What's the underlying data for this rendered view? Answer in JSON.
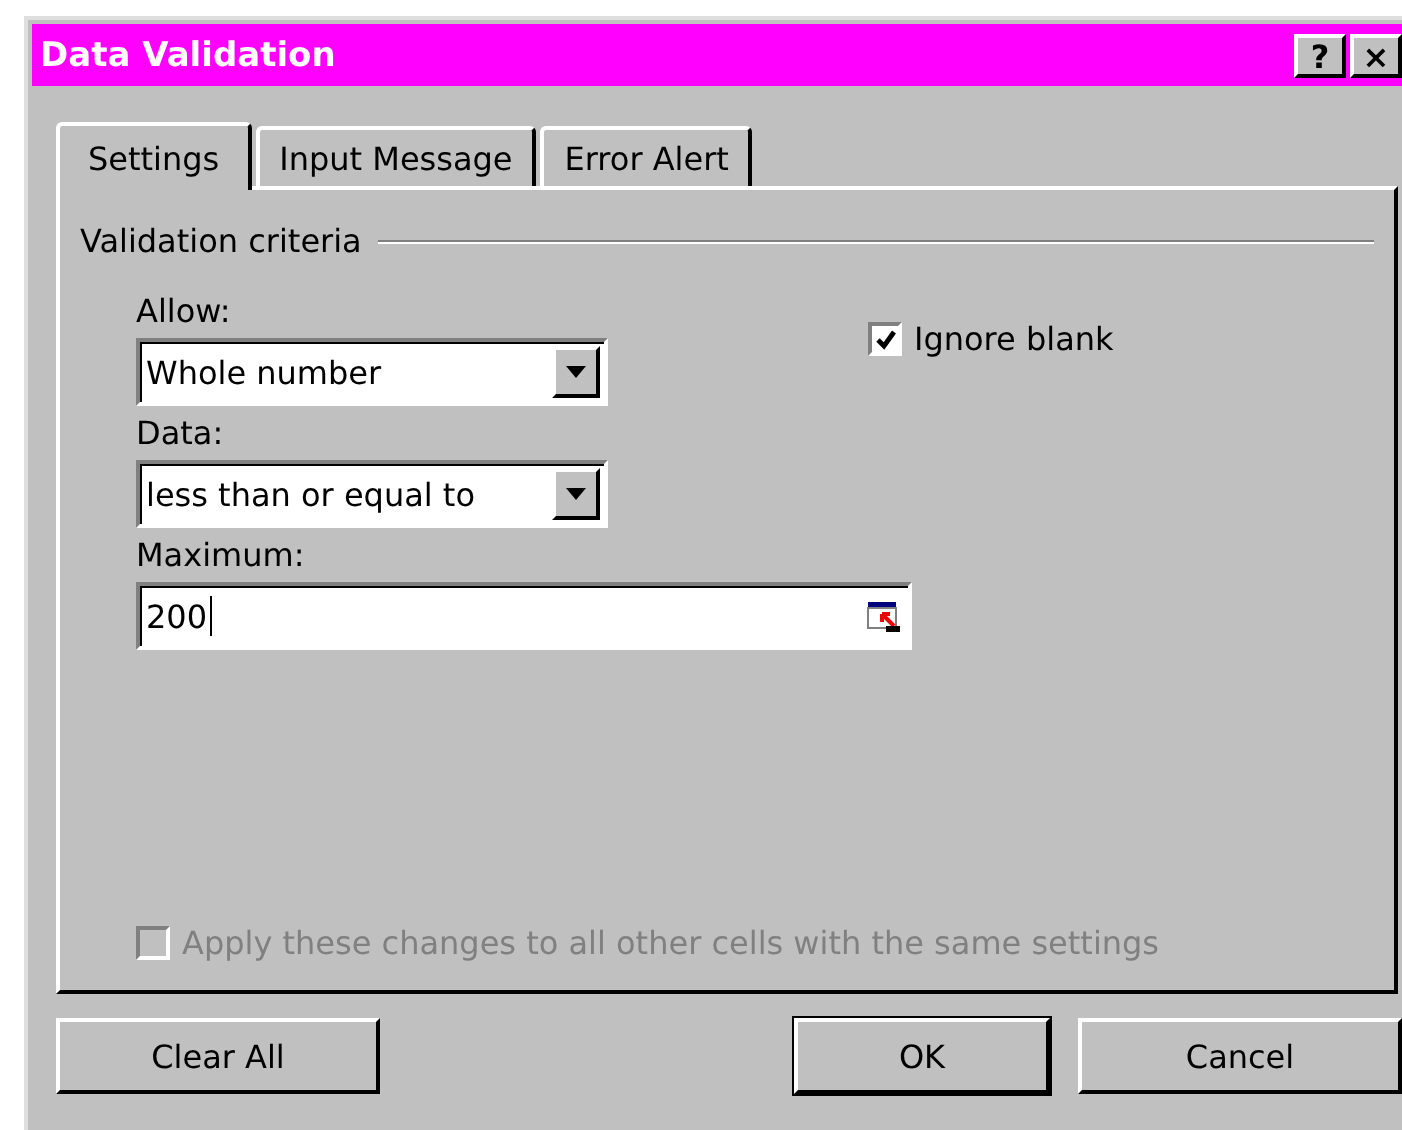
{
  "window": {
    "title": "Data Validation",
    "title_buttons": [
      "?",
      "×"
    ]
  },
  "tabs": [
    {
      "label": "Settings",
      "selected": true
    },
    {
      "label": "Input Message",
      "selected": false
    },
    {
      "label": "Error Alert",
      "selected": false
    }
  ],
  "group": {
    "title": "Validation criteria"
  },
  "allow": {
    "label": "Allow:",
    "value": "Whole number"
  },
  "ignore_blank": {
    "label": "Ignore blank",
    "checked": true
  },
  "data": {
    "label": "Data:",
    "value": "less than or equal to"
  },
  "maximum": {
    "label": "Maximum:",
    "value": "200"
  },
  "apply_all": {
    "label": "Apply these changes to all other cells with the same settings",
    "checked": false,
    "disabled": true
  },
  "buttons": [
    {
      "label": "Clear All",
      "kind": "left"
    },
    {
      "label": "OK",
      "kind": "default"
    },
    {
      "label": "Cancel",
      "kind": "normal"
    }
  ]
}
